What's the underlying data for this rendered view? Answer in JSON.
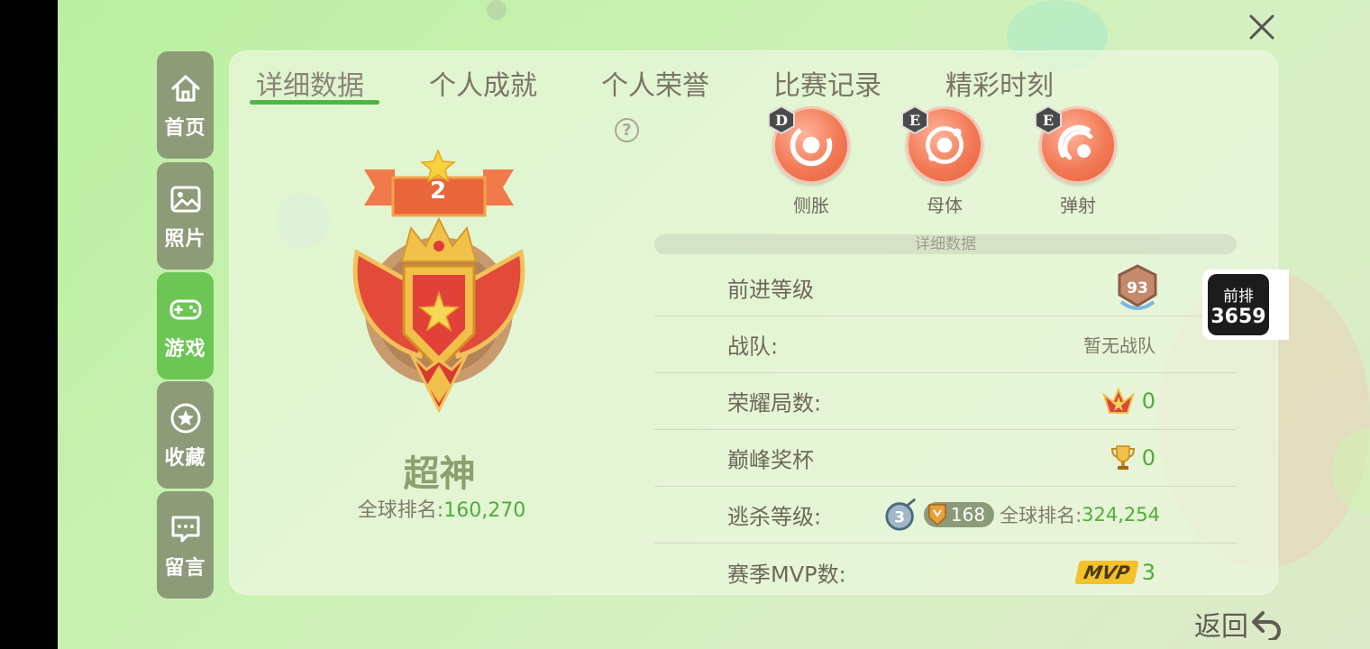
{
  "sidebar": {
    "items": [
      {
        "label": "首页",
        "icon": "home-icon"
      },
      {
        "label": "照片",
        "icon": "photo-icon"
      },
      {
        "label": "游戏",
        "icon": "gamepad-icon",
        "active": true
      },
      {
        "label": "收藏",
        "icon": "star-icon"
      },
      {
        "label": "留言",
        "icon": "message-icon"
      }
    ]
  },
  "tabs": [
    {
      "label": "详细数据",
      "active": true
    },
    {
      "label": "个人成就"
    },
    {
      "label": "个人荣誉"
    },
    {
      "label": "比赛记录"
    },
    {
      "label": "精彩时刻"
    }
  ],
  "medal": {
    "level": "2",
    "title": "超神",
    "rank_label": "全球排名:",
    "rank_value": "160,270"
  },
  "skills": [
    {
      "grade": "D",
      "name": "侧胀"
    },
    {
      "grade": "E",
      "name": "母体"
    },
    {
      "grade": "E",
      "name": "弹射"
    }
  ],
  "details": {
    "header": "详细数据",
    "rows": [
      {
        "label": "前进等级",
        "value": "93"
      },
      {
        "label": "战队:",
        "value": "暂无战队"
      },
      {
        "label": "荣耀局数:",
        "value": "0"
      },
      {
        "label": "巅峰奖杯",
        "value": "0"
      },
      {
        "label": "逃杀等级:",
        "level": "3",
        "pill": "168",
        "rank_label": "全球排名:",
        "rank_value": "324,254"
      },
      {
        "label": "赛季MVP数:",
        "tag": "MVP",
        "value": "3"
      }
    ]
  },
  "float_widget": {
    "line1": "前排",
    "line2": "3659"
  },
  "back_label": "返回",
  "colors": {
    "accent": "#4fb543",
    "active_tab_bg": "#6cc655",
    "orange": "#f27a56"
  }
}
